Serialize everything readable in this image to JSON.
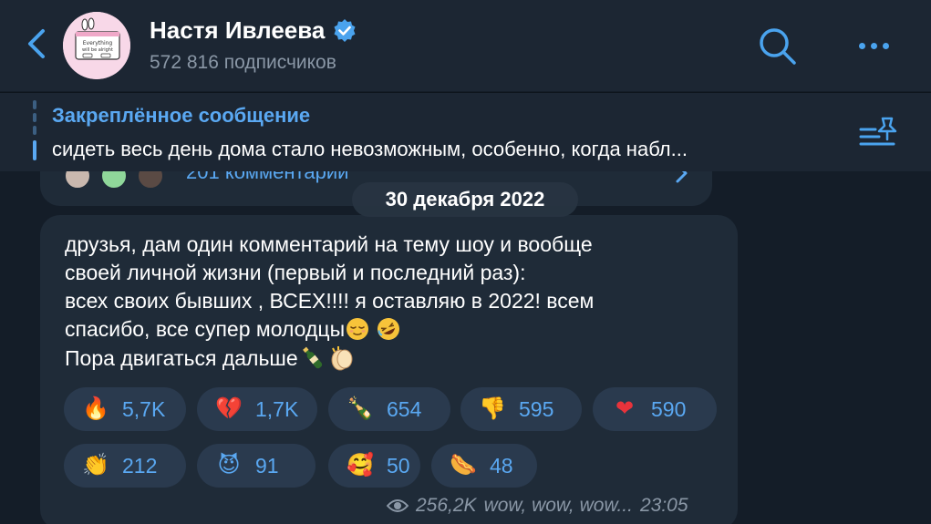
{
  "header": {
    "channel_name": "Настя Ивлеева",
    "subscribers": "572 816 подписчиков",
    "avatar_text_1": "Everything",
    "avatar_text_2": "will be alright"
  },
  "pinned": {
    "title": "Закреплённое сообщение",
    "text": "сидеть весь день дома стало невозможным, особенно, когда набл..."
  },
  "previous_post": {
    "comments": "201 комментарий"
  },
  "date_separator": "30 декабря 2022",
  "message": {
    "lines": [
      "друзья, дам один комментарий на тему шоу и вообще",
      "своей личной жизни (первый и последний раз):",
      "всех своих бывших , ВСЕХ!!!! я оставляю в 2022! всем",
      "спасибо, все супер молодцы",
      "Пора двигаться дальше"
    ],
    "reactions": [
      {
        "emoji": "fire-icon",
        "glyph": "🔥",
        "count": "5,7K"
      },
      {
        "emoji": "broken-heart-icon",
        "glyph": "💔",
        "count": "1,7K"
      },
      {
        "emoji": "champagne-icon",
        "glyph": "🍾",
        "count": "654"
      },
      {
        "emoji": "thumbs-down-icon",
        "glyph": "👎",
        "count": "595"
      },
      {
        "emoji": "red-heart-icon",
        "glyph": "❤",
        "count": "590"
      },
      {
        "emoji": "clap-icon",
        "glyph": "👏",
        "count": "212"
      },
      {
        "emoji": "smiling-devil-icon",
        "glyph": "😈",
        "count": "91"
      },
      {
        "emoji": "smiling-face-hearts-icon",
        "glyph": "🥰",
        "count": "50"
      },
      {
        "emoji": "hotdog-icon",
        "glyph": "🌭",
        "count": "48"
      }
    ],
    "views": "256,2K",
    "signature": "wow, wow, wow...",
    "time": "23:05"
  },
  "colors": {
    "accent": "#5aa8f2",
    "background": "#141d28",
    "header": "#1c2633",
    "bubble": "#1f2b38",
    "reaction_bg": "#2a3a4e",
    "secondary_text": "#8a97a6"
  }
}
